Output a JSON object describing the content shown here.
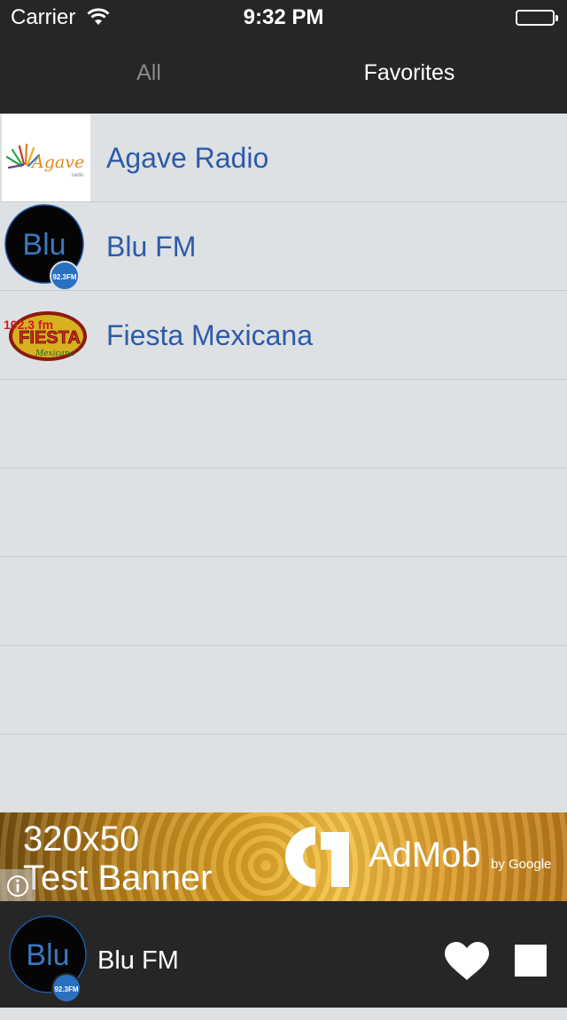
{
  "status_bar": {
    "carrier": "Carrier",
    "time": "9:32 PM"
  },
  "tabs": {
    "all": "All",
    "favorites": "Favorites",
    "selected": "Favorites"
  },
  "stations": [
    {
      "name": "Agave Radio",
      "logo_text": "Agave",
      "logo_sub": "radio",
      "logo_icon": "agave-logo-icon"
    },
    {
      "name": "Blu FM",
      "logo_text": "Blu",
      "logo_badge": "92.3FM",
      "logo_icon": "blu-fm-logo-icon"
    },
    {
      "name": "Fiesta Mexicana",
      "logo_text": "FIESTA",
      "logo_freq": "102.3 fm",
      "logo_sub": "Mexicana",
      "logo_icon": "fiesta-mexicana-logo-icon"
    }
  ],
  "ad": {
    "line1": "320x50",
    "line2": "Test Banner",
    "brand": "AdMob",
    "by": "by Google"
  },
  "player": {
    "station": "Blu FM",
    "logo_text": "Blu",
    "logo_badge": "92.3FM"
  },
  "colors": {
    "bar_bg": "#262626",
    "list_bg": "#dde1e4",
    "station_text": "#2e5aa8",
    "tab_active": "#ffffff",
    "tab_inactive": "#8a8a8a"
  }
}
